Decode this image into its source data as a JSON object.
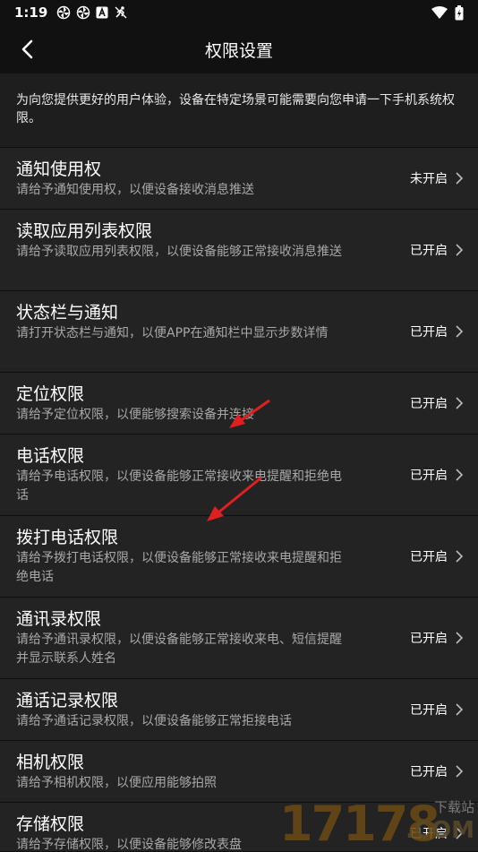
{
  "status_bar": {
    "time": "1:19",
    "icons": [
      "pinwheel-icon",
      "pinwheel-icon",
      "text-a-icon",
      "no-run-icon"
    ],
    "right_icons": [
      "wifi-icon",
      "battery-icon"
    ]
  },
  "header": {
    "title": "权限设置"
  },
  "intro": "为向您提供更好的用户体验，设备在特定场景可能需要向您申请一下手机系统权限。",
  "items": [
    {
      "title": "通知使用权",
      "desc": "请给予通知使用权，以便设备接收消息推送",
      "status": "未开启"
    },
    {
      "title": "读取应用列表权限",
      "desc": "请给予读取应用列表权限，以便设备能够正常接收消息推送",
      "status": "已开启"
    },
    {
      "title": "状态栏与通知",
      "desc": "请打开状态栏与通知，以便APP在通知栏中显示步数详情",
      "status": "已开启"
    },
    {
      "title": "定位权限",
      "desc": "请给予定位权限，以便能够搜索设备并连接",
      "status": "已开启"
    },
    {
      "title": "电话权限",
      "desc": "请给予电话权限，以便设备能够正常接收来电提醒和拒绝电话",
      "status": "已开启"
    },
    {
      "title": "拨打电话权限",
      "desc": "请给予拨打电话权限，以便设备能够正常接收来电提醒和拒绝电话",
      "status": "已开启"
    },
    {
      "title": "通讯录权限",
      "desc": "请给予通讯录权限，以便设备能够正常接收来电、短信提醒并显示联系人姓名",
      "status": "已开启"
    },
    {
      "title": "通话记录权限",
      "desc": "请给予通话记录权限，以便设备能够正常拒接电话",
      "status": "已开启"
    },
    {
      "title": "相机权限",
      "desc": "请给予相机权限，以便应用能够拍照",
      "status": "已开启"
    },
    {
      "title": "存储权限",
      "desc": "请给予存储权限，以便设备能够修改表盘",
      "status": "已开启"
    }
  ],
  "watermark": {
    "number": "17178",
    "small": "下载站",
    "domain": ".COM"
  },
  "colors": {
    "background": "#111111",
    "list_bg": "#232323",
    "annotation_arrow": "#e02020"
  }
}
